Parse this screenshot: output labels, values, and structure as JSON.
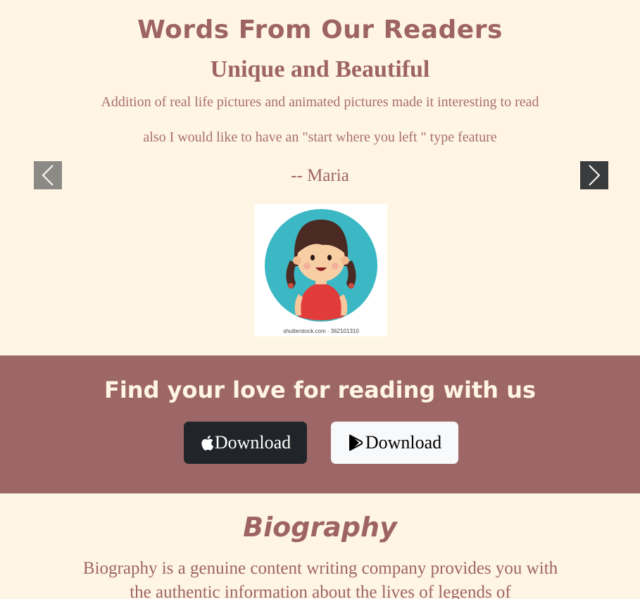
{
  "testimonials": {
    "heading": "Words From Our Readers",
    "subtitle": "Unique and Beautiful",
    "line1": "Addition of real life pictures and animated pictures made it interesting to read",
    "line2": "also I would like to have an \"start where you left \" type feature",
    "author": "-- Maria",
    "avatar_caption": "shutterstock.com · 362101310",
    "prev_icon": "chevron-left-icon",
    "next_icon": "chevron-right-icon"
  },
  "cta": {
    "title": "Find your love for reading with us",
    "apple_button": {
      "icon": "apple-icon",
      "label": "Download"
    },
    "play_button": {
      "icon": "google-play-icon",
      "label": "Download"
    }
  },
  "bio": {
    "title": "Biography",
    "text": "Biography is a genuine content writing company provides you with the authentic information about the lives of legends of"
  },
  "colors": {
    "background": "#fff5e4",
    "accent": "#9e6767",
    "text": "#9e6464",
    "dark_button": "#212529",
    "light_button": "#f8f9fa"
  }
}
